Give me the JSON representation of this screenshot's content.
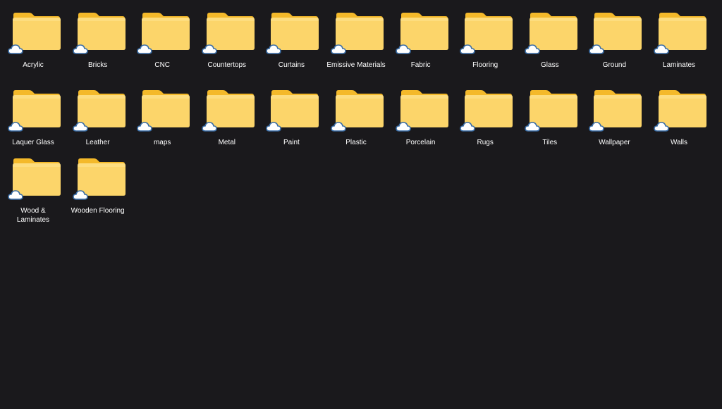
{
  "folders": [
    {
      "name": "Acrylic"
    },
    {
      "name": "Bricks"
    },
    {
      "name": "CNC"
    },
    {
      "name": "Countertops"
    },
    {
      "name": "Curtains"
    },
    {
      "name": "Emissive Materials"
    },
    {
      "name": "Fabric"
    },
    {
      "name": "Flooring"
    },
    {
      "name": "Glass"
    },
    {
      "name": "Ground"
    },
    {
      "name": "Laminates"
    },
    {
      "name": "Laquer Glass"
    },
    {
      "name": "Leather"
    },
    {
      "name": "maps"
    },
    {
      "name": "Metal"
    },
    {
      "name": "Paint"
    },
    {
      "name": "Plastic"
    },
    {
      "name": "Porcelain"
    },
    {
      "name": "Rugs"
    },
    {
      "name": "Tiles"
    },
    {
      "name": "Wallpaper"
    },
    {
      "name": "Walls"
    },
    {
      "name": "Wood & Laminates"
    },
    {
      "name": "Wooden Flooring"
    }
  ],
  "icons": {
    "folder": "folder-icon",
    "status": "cloud-icon"
  },
  "colors": {
    "background": "#1a191c",
    "folder_front": "#fcd56a",
    "folder_back": "#f4b92a",
    "label": "#ffffff"
  }
}
